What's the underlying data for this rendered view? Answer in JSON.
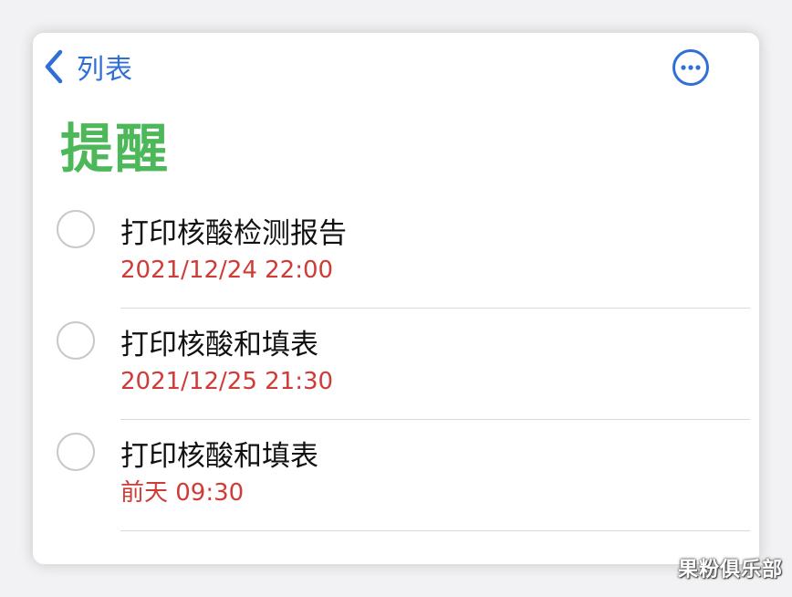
{
  "nav": {
    "back_label": "列表",
    "back_icon": "chevron-left-icon",
    "more_icon": "ellipsis-circle-icon"
  },
  "title": "提醒",
  "reminders": [
    {
      "title": "打印核酸检测报告",
      "time": "2021/12/24 22:00"
    },
    {
      "title": "打印核酸和填表",
      "time": "2021/12/25 21:30"
    },
    {
      "title": "打印核酸和填表",
      "time": "前天 09:30"
    }
  ],
  "watermark": "果粉俱乐部",
  "colors": {
    "accent_blue": "#2f6fd6",
    "title_green": "#4cb85a",
    "due_red": "#d03b37",
    "checkbox_gray": "#c7c7cc"
  }
}
